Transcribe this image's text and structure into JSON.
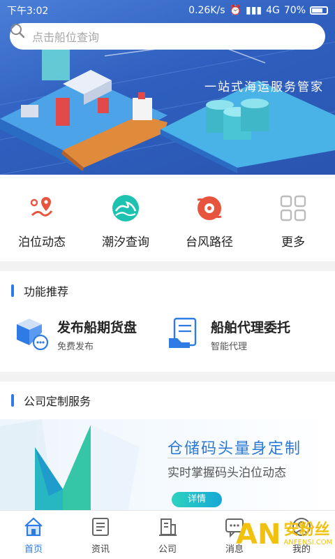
{
  "status_bar": {
    "time": "下午3:02",
    "speed": "0.26K/s",
    "network": "4G",
    "battery": "70%"
  },
  "search": {
    "placeholder": "点击船位查询"
  },
  "hero": {
    "slogan": "一站式海运服务管家"
  },
  "quick_actions": [
    {
      "label": "泊位动态",
      "icon": "route-pin-icon"
    },
    {
      "label": "潮汐查询",
      "icon": "wave-icon"
    },
    {
      "label": "台风路径",
      "icon": "typhoon-icon"
    },
    {
      "label": "更多",
      "icon": "grid-icon"
    }
  ],
  "recommend": {
    "title": "功能推荐",
    "items": [
      {
        "title": "发布船期货盘",
        "subtitle": "免费发布"
      },
      {
        "title": "船舶代理委托",
        "subtitle": "智能代理"
      }
    ]
  },
  "custom": {
    "title": "公司定制服务",
    "banner_title": "仓储码头量身定制",
    "banner_subtitle": "实时掌握码头泊位动态",
    "banner_button": "详情"
  },
  "tabs": [
    {
      "label": "首页",
      "active": true
    },
    {
      "label": "资讯",
      "active": false
    },
    {
      "label": "公司",
      "active": false
    },
    {
      "label": "消息",
      "active": false
    },
    {
      "label": "我的",
      "active": false
    }
  ],
  "watermark": {
    "brand": "AN",
    "cn": "安粉丝",
    "url": "ANFENSI.COM"
  },
  "colors": {
    "accent": "#2e7be5",
    "teal": "#1ec2b0",
    "red": "#e8553e"
  }
}
